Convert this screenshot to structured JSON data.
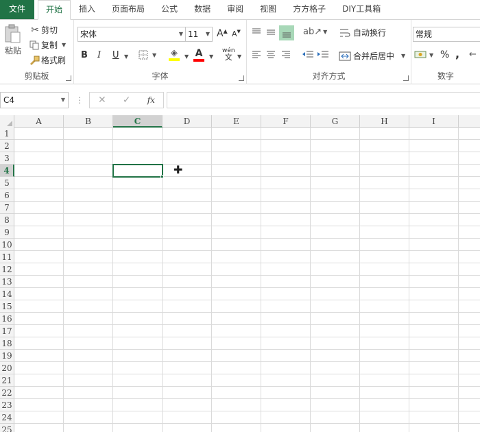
{
  "tabs": [
    "文件",
    "开始",
    "插入",
    "页面布局",
    "公式",
    "数据",
    "审阅",
    "视图",
    "方方格子",
    "DIY工具箱"
  ],
  "clipboard": {
    "paste": "粘贴",
    "cut": "剪切",
    "copy": "复制",
    "format_painter": "格式刷",
    "label": "剪贴板"
  },
  "font": {
    "name": "宋体",
    "size": "11",
    "bold": "B",
    "italic": "I",
    "underline": "U",
    "grow": "A",
    "shrink": "A",
    "phonetic_top": "wén",
    "phonetic_bottom": "文",
    "label": "字体",
    "fill_color": "#ffff00",
    "font_color": "#ff0000"
  },
  "align": {
    "wrap": "自动换行",
    "merge": "合并后居中",
    "label": "对齐方式"
  },
  "number": {
    "format": "常规",
    "percent": "%",
    "comma": ",",
    "label": "数字"
  },
  "formula_bar": {
    "name_box": "C4",
    "fx": "fx",
    "cancel": "✕",
    "confirm": "✓",
    "sep": "⋮",
    "value": ""
  },
  "grid": {
    "columns": [
      "A",
      "B",
      "C",
      "D",
      "E",
      "F",
      "G",
      "H",
      "I"
    ],
    "rows": [
      "1",
      "2",
      "3",
      "4",
      "5",
      "6",
      "7",
      "8",
      "9",
      "10",
      "11",
      "12",
      "13",
      "14",
      "15",
      "16",
      "17",
      "18",
      "19",
      "20",
      "21",
      "22",
      "23",
      "24",
      "25"
    ],
    "active_col": "C",
    "active_row": "4"
  },
  "colors": {
    "accent": "#217346"
  }
}
